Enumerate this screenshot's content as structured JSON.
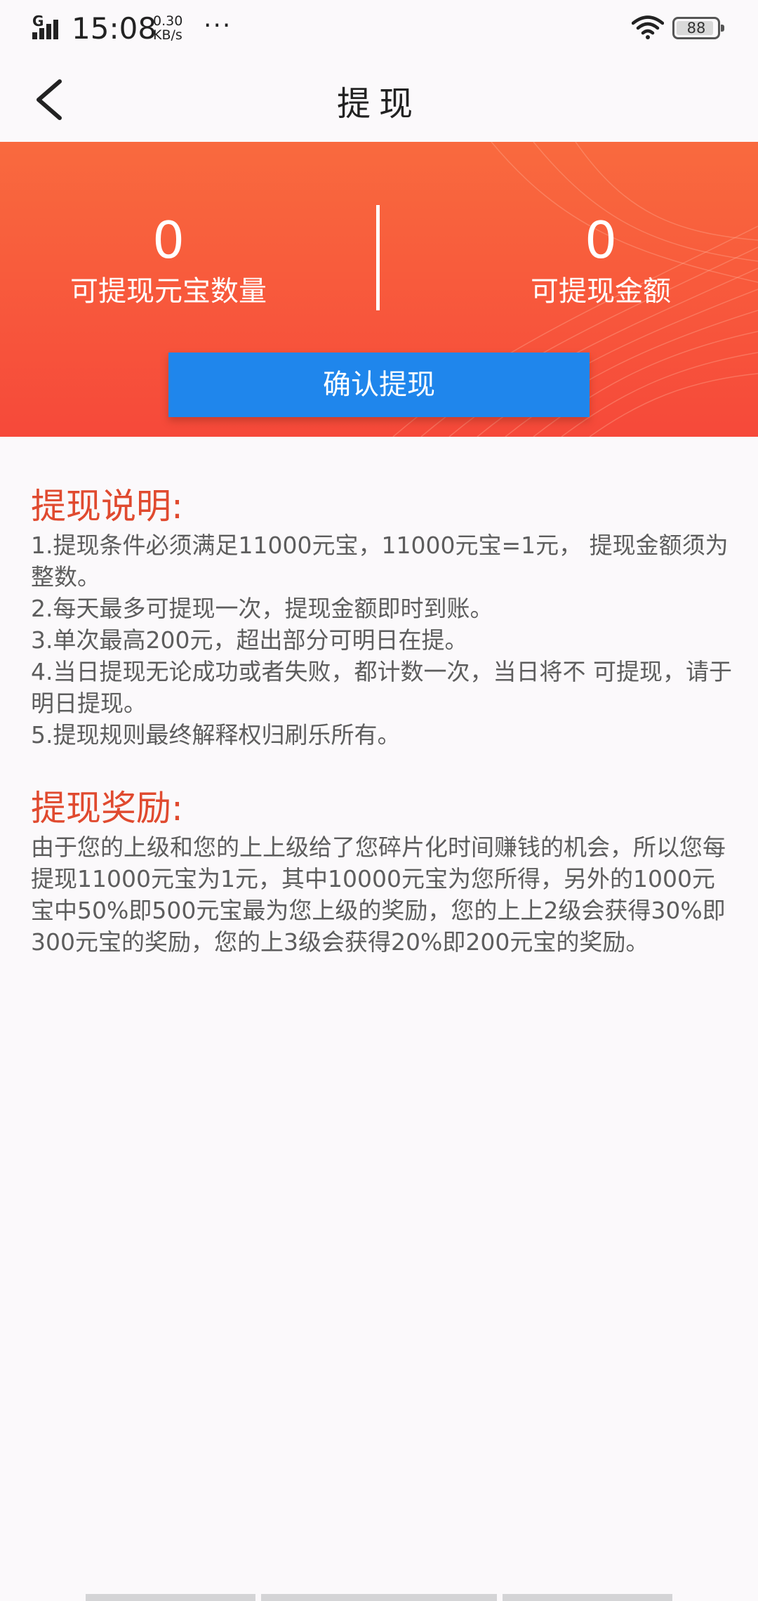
{
  "status_bar": {
    "network": "G",
    "time": "15:08",
    "speed_value": "0.30",
    "speed_unit": "KB/s",
    "more": "···",
    "battery": "88"
  },
  "nav": {
    "title": "提现",
    "back_icon": "chevron-left-icon"
  },
  "summary": {
    "left_value": "0",
    "left_label": "可提现元宝数量",
    "right_value": "0",
    "right_label": "可提现金额",
    "confirm_label": "确认提现"
  },
  "instructions": {
    "title": "提现说明:",
    "items": [
      "1.提现条件必须满足11000元宝，11000元宝=1元， 提现金额须为整数。",
      "2.每天最多可提现一次，提现金额即时到账。",
      "3.单次最高200元，超出部分可明日在提。",
      "4.当日提现无论成功或者失败，都计数一次，当日将不 可提现，请于明日提现。",
      "5.提现规则最终解释权归刷乐所有。"
    ]
  },
  "reward": {
    "title": "提现奖励:",
    "text": "由于您的上级和您的上上级给了您碎片化时间赚钱的机会，所以您每提现11000元宝为1元，其中10000元宝为您所得，另外的1000元宝中50%即500元宝最为您上级的奖励，您的上上2级会获得30%即300元宝的奖励，您的上3级会获得20%即200元宝的奖励。"
  },
  "colors": {
    "banner_top": "#f96a3e",
    "banner_bottom": "#f6493a",
    "button": "#1f86ec",
    "section_title": "#e04a2f"
  }
}
